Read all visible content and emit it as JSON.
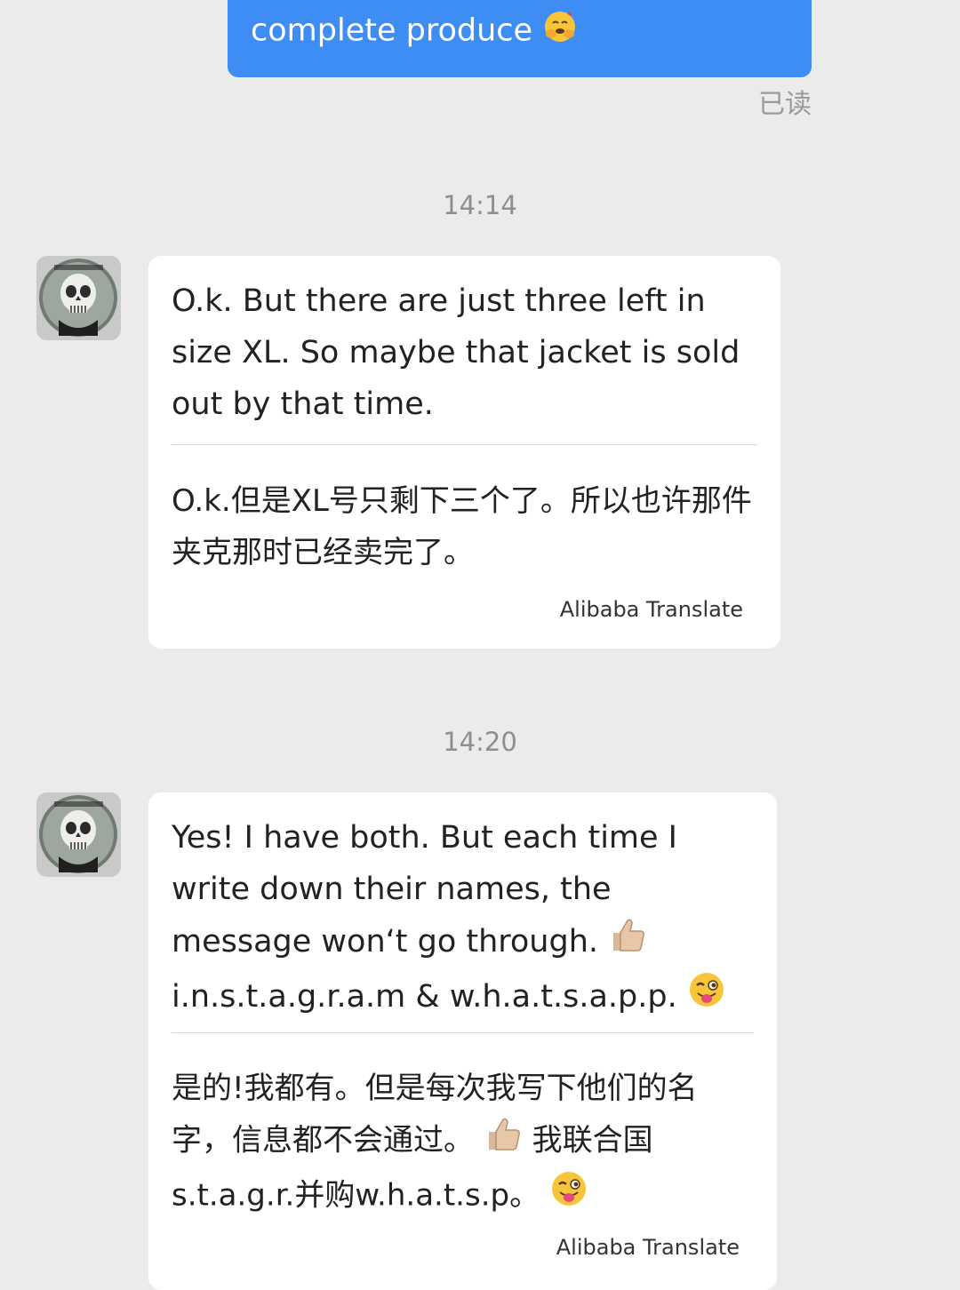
{
  "sent_message": {
    "text": "complete produce",
    "emoji_icon": "hugging-face-emoji",
    "read_status": "已读"
  },
  "messages": [
    {
      "timestamp": "14:14",
      "original": "O.k. But there are just three left in size XL. So maybe that jacket is sold out by that time.",
      "translation": "O.k.但是XL号只剩下三个了。所以也许那件夹克那时已经卖完了。",
      "translator": "Alibaba Translate"
    },
    {
      "timestamp": "14:20",
      "original_part1": "Yes! I have both. But each time I write down their names, the message won‘t go through.",
      "original_part2": "i.n.s.t.a.g.r.a.m &",
      "original_part3": "w.h.a.t.s.a.p.p.",
      "translation_part1": "是的!我都有。但是每次我写下他们的名字，信息都不会通过。",
      "translation_part2": "我联合国",
      "translation_part3": "s.t.a.g.r.并购w.h.a.t.s.p。",
      "translator": "Alibaba Translate"
    }
  ],
  "colors": {
    "sent_bubble": "#3d8df5",
    "received_bubble": "#ffffff",
    "background": "#ebebeb"
  }
}
